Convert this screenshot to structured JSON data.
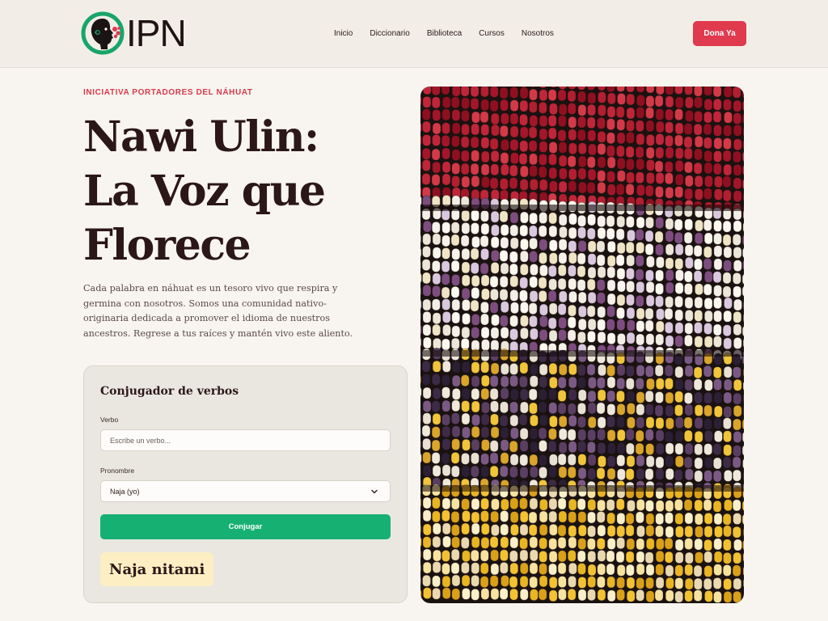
{
  "header": {
    "logo_text": "IPN",
    "nav": [
      "Inicio",
      "Diccionario",
      "Biblioteca",
      "Cursos",
      "Nosotros"
    ],
    "donate_label": "Dona Ya"
  },
  "hero": {
    "eyebrow": "INICIATIVA PORTADORES DEL NÁHUAT",
    "title_lines": [
      "Nawi Ulin:",
      "La Voz que",
      "Florece"
    ],
    "description": "Cada palabra en náhuat es un tesoro vivo que respira y germina con nosotros. Somos una comunidad nativo-originaria dedicada a promover el idioma de nuestros ancestros. Regrese a tus raíces y mantén vivo este aliento."
  },
  "conjugator": {
    "title": "Conjugador de verbos",
    "verb_label": "Verbo",
    "verb_placeholder": "Escribe un verbo...",
    "verb_value": "",
    "pronoun_label": "Pronombre",
    "pronoun_selected": "Naja (yo)",
    "submit_label": "Conjugar",
    "result": "Naja nitami"
  },
  "image": {
    "subject": "multicolored-corn-cobs"
  },
  "colors": {
    "accent_red": "#e03a4f",
    "accent_green": "#16b073",
    "result_bg": "#fdefc3",
    "background": "#f8f5f0",
    "header_bg": "#f2eee7"
  },
  "icons": {
    "logo": "indigenous-profile-logo-icon",
    "select_chevron": "chevron-down-icon"
  }
}
